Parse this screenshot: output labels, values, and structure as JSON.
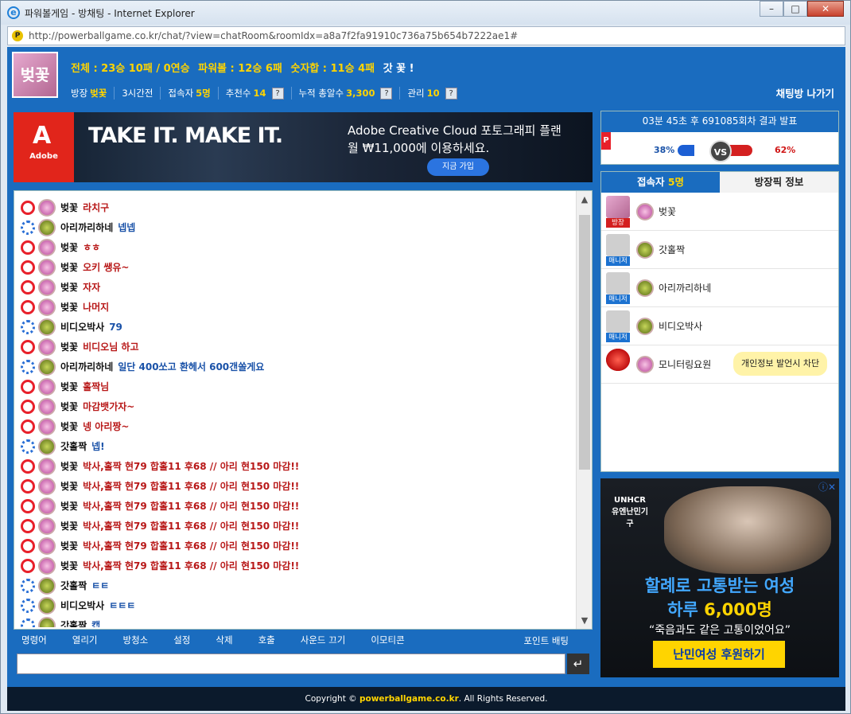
{
  "window": {
    "title": "파워볼게임 - 방채팅 - Internet Explorer",
    "url": "http://powerballgame.co.kr/chat/?view=chatRoom&roomIdx=a8a7f2fa91910c736a75b654b7222ae1#"
  },
  "header": {
    "avatar_label": "벚꽃",
    "stat_total": "전체 : 23승 10패 / 0연승",
    "stat_powerball": "파워볼 : 12승 6패",
    "stat_sum": "숫자합 : 11승 4패",
    "tagline": "갓 꽃 !",
    "room_owner_label": "방장",
    "room_owner": "벚꽃",
    "time_ago": "3시간전",
    "users_label": "접속자",
    "users_count": "5명",
    "recommend_label": "추천수",
    "recommend_count": "14",
    "total_recommend_label": "누적 총알수",
    "total_recommend_count": "3,300",
    "manage_label": "관리",
    "manage_count": "10",
    "help": "?",
    "exit": "채팅방 나가기"
  },
  "ad_top": {
    "brand": "Adobe",
    "logo_glyph": "A",
    "headline": "TAKE IT. MAKE IT.",
    "line1": "Adobe Creative Cloud 포토그래피 플랜",
    "line2": "월 ₩11,000에 이용하세요.",
    "button": "지금 가입"
  },
  "messages": [
    {
      "badge": "red",
      "rank": "pink",
      "nick": "벚꽃",
      "text": "라치구",
      "color": "r"
    },
    {
      "badge": "blue",
      "rank": "green",
      "nick": "아리까리하네",
      "text": "넵넵",
      "color": "b"
    },
    {
      "badge": "red",
      "rank": "pink",
      "nick": "벚꽃",
      "text": "ㅎㅎ",
      "color": "r"
    },
    {
      "badge": "red",
      "rank": "pink",
      "nick": "벚꽃",
      "text": "오키 쌩유~",
      "color": "r"
    },
    {
      "badge": "red",
      "rank": "pink",
      "nick": "벚꽃",
      "text": "자자",
      "color": "r"
    },
    {
      "badge": "red",
      "rank": "pink",
      "nick": "벚꽃",
      "text": "나머지",
      "color": "r"
    },
    {
      "badge": "blue",
      "rank": "green",
      "nick": "비디오박사",
      "text": "79",
      "color": "b"
    },
    {
      "badge": "red",
      "rank": "pink",
      "nick": "벚꽃",
      "text": "비디오님 하고",
      "color": "r"
    },
    {
      "badge": "blue",
      "rank": "green",
      "nick": "아리까리하네",
      "text": "일단 400쏘고 환헤서 600갠쏠게요",
      "color": "b"
    },
    {
      "badge": "red",
      "rank": "pink",
      "nick": "벚꽃",
      "text": "홀짝님",
      "color": "r"
    },
    {
      "badge": "red",
      "rank": "pink",
      "nick": "벚꽃",
      "text": "마감뱃가자~",
      "color": "r"
    },
    {
      "badge": "red",
      "rank": "pink",
      "nick": "벚꽃",
      "text": "넹 아리짱~",
      "color": "r"
    },
    {
      "badge": "blue",
      "rank": "green",
      "nick": "갓홀짝",
      "text": "넵!",
      "color": "b"
    },
    {
      "badge": "red",
      "rank": "pink",
      "nick": "벚꽃",
      "text": "박사,홀짝 현79 합홀11 후68 // 아리 현150 마감!!",
      "color": "r"
    },
    {
      "badge": "red",
      "rank": "pink",
      "nick": "벚꽃",
      "text": "박사,홀짝 현79 합홀11 후68 // 아리 현150 마감!!",
      "color": "r"
    },
    {
      "badge": "red",
      "rank": "pink",
      "nick": "벚꽃",
      "text": "박사,홀짝 현79 합홀11 후68 // 아리 현150 마감!!",
      "color": "r"
    },
    {
      "badge": "red",
      "rank": "pink",
      "nick": "벚꽃",
      "text": "박사,홀짝 현79 합홀11 후68 // 아리 현150 마감!!",
      "color": "r"
    },
    {
      "badge": "red",
      "rank": "pink",
      "nick": "벚꽃",
      "text": "박사,홀짝 현79 합홀11 후68 // 아리 현150 마감!!",
      "color": "r"
    },
    {
      "badge": "red",
      "rank": "pink",
      "nick": "벚꽃",
      "text": "박사,홀짝 현79 합홀11 후68 // 아리 현150 마감!!",
      "color": "r"
    },
    {
      "badge": "blue",
      "rank": "green",
      "nick": "갓홀짝",
      "text": "ㅌㅌ",
      "color": "b"
    },
    {
      "badge": "blue",
      "rank": "green",
      "nick": "비디오박사",
      "text": "ㅌㅌㅌ",
      "color": "b"
    },
    {
      "badge": "blue",
      "rank": "green",
      "nick": "갓홀짝",
      "text": "캡",
      "color": "b"
    }
  ],
  "toolbar": [
    "명령어",
    "열리기",
    "방청소",
    "설정",
    "삭제",
    "호출",
    "사운드 끄기",
    "이모티콘"
  ],
  "toolbar_point": "포인트 배팅",
  "input": {
    "placeholder": "",
    "send": "↵"
  },
  "result": {
    "header": "03분 45초 후 691085회차 결과 발표",
    "p": "P",
    "left_pct": "38%",
    "right_pct": "62%",
    "vs": "VS",
    "left_fill": 0.38,
    "right_fill": 0.62
  },
  "users_panel": {
    "tab_users_label": "접속자",
    "tab_users_count": "5명",
    "tab_info": "방장픽 정보",
    "users": [
      {
        "role": "방장",
        "role_color": "red",
        "avatar": "pink",
        "name": "벚꽃"
      },
      {
        "role": "매니저",
        "role_color": "blue",
        "avatar": "gray",
        "name": "갓홀짝"
      },
      {
        "role": "매니저",
        "role_color": "blue",
        "avatar": "gray",
        "name": "아리까리하네"
      },
      {
        "role": "매니저",
        "role_color": "blue",
        "avatar": "gray",
        "name": "비디오박사"
      },
      {
        "role": "",
        "role_color": "",
        "avatar": "siren",
        "name": "모니터링요원",
        "tip": "개인정보 발언시 차단"
      }
    ]
  },
  "ad_right": {
    "org": "UNHCR 유엔난민기구",
    "line1": "할례로 고통받는 여성",
    "line2a": "하루 ",
    "line2b": "6,000명",
    "quote": "“죽음과도 같은 고통이었어요”",
    "cta": "난민여성 후원하기",
    "close": "ⓘ✕"
  },
  "footer": {
    "pre": "Copyright © ",
    "site": "powerballgame.co.kr",
    "post": ". All Rights Reserved."
  }
}
